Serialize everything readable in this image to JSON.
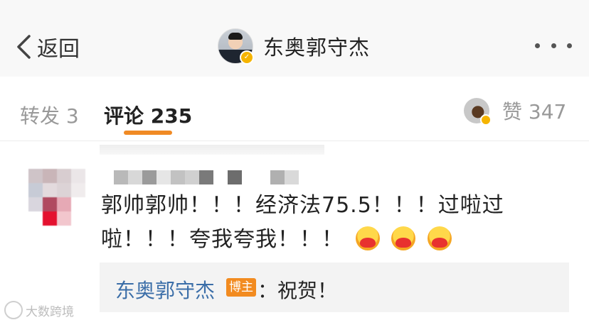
{
  "header": {
    "back_label": "返回",
    "account_name": "东奥郭守杰",
    "more_icon": "more-dots-icon"
  },
  "tabs": {
    "repost": "转发 3",
    "comments": "评论 235",
    "likes": "赞 347"
  },
  "comment": {
    "text": "郭帅郭帅！！！经济法75.5！！！过啦过啦！！！夸我夸我！！！",
    "emoji_count": 3
  },
  "reply": {
    "author": "东奥郭守杰",
    "badge": "博主",
    "text": "：祝贺！"
  },
  "watermark": "大数跨境",
  "colors": {
    "accent_underline": "#f08a24",
    "reply_author": "#3b6ea8",
    "owner_badge": "#f28b20"
  }
}
